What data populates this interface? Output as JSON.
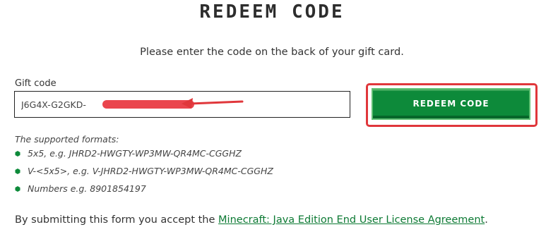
{
  "header": {
    "title": "REDEEM CODE"
  },
  "intro": {
    "text": "Please enter the code on the back of your gift card."
  },
  "form": {
    "gift_label": "Gift code",
    "gift_value": "J6G4X-G2GKD-",
    "redeem_label": "REDEEM CODE"
  },
  "formats": {
    "heading": "The supported formats:",
    "items": [
      "5x5, e.g. JHRD2-HWGTY-WP3MW-QR4MC-CGGHZ",
      "V-<5x5>, e.g. V-JHRD2-HWGTY-WP3MW-QR4MC-CGGHZ",
      "Numbers e.g. 8901854197"
    ]
  },
  "footer": {
    "prefix": "By submitting this form you accept the ",
    "link_text": "Minecraft: Java Edition End User License Agreement",
    "suffix": "."
  },
  "colors": {
    "accent_green": "#0d8a3a",
    "annotation_red": "#e0373b",
    "link_green": "#0d7a34"
  }
}
